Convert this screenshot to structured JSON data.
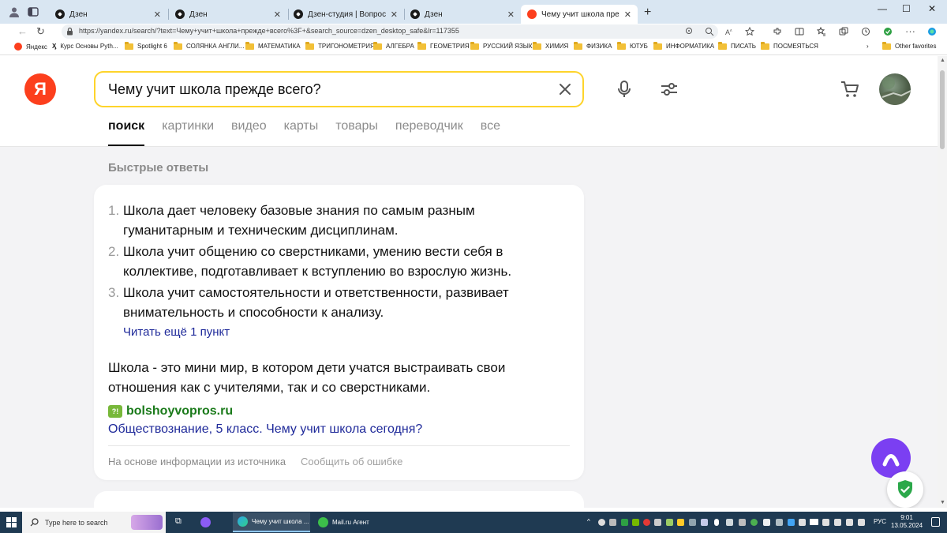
{
  "browser": {
    "tabs": [
      {
        "title": "Дзен",
        "type": "dzen"
      },
      {
        "title": "Дзен",
        "type": "dzen"
      },
      {
        "title": "Дзен-студия | Вопрос, на которо",
        "type": "dzen"
      },
      {
        "title": "Дзен",
        "type": "dzen"
      },
      {
        "title": "Чему учит школа прежде всего",
        "type": "yandex",
        "active": true
      }
    ],
    "url": "https://yandex.ru/search/?text=Чему+учит+школа+прежде+всего%3F+&search_source=dzen_desktop_safe&lr=117355",
    "bookmarks": [
      "Яндекс",
      "Курс Основы Pyth...",
      "Spotlight 6",
      "СОЛЯНКА АНГЛИ...",
      "МАТЕМАТИКА",
      "ТРИГОНОМЕТРИЯ",
      "АЛГЕБРА",
      "ГЕОМЕТРИЯ",
      "РУССКИЙ ЯЗЫК",
      "ХИМИЯ",
      "ФИЗИКА",
      "ЮТУБ",
      "ИНФОРМАТИКА",
      "ПИСАТЬ",
      "ПОСМЕЯТЬСЯ"
    ],
    "other_favorites": "Other favorites"
  },
  "search": {
    "query": "Чему учит школа прежде всего?",
    "logo": "Я",
    "tabs": [
      "поиск",
      "картинки",
      "видео",
      "карты",
      "товары",
      "переводчик",
      "все"
    ]
  },
  "quick_answers": {
    "title": "Быстрые ответы",
    "items": [
      {
        "num": "1.",
        "text": "Школа дает человеку базовые знания по самым разным гуманитарным и техническим дисциплинам."
      },
      {
        "num": "2.",
        "text": "Школа учит общению со сверстниками, умению вести себя в коллективе, подготавливает к вступлению во взрослую жизнь."
      },
      {
        "num": "3.",
        "text": "Школа учит самостоятельности и ответственности, развивает внимательность и способности к анализу."
      }
    ],
    "more_link": "Читать ещё 1 пункт",
    "summary": "Школа - это мини мир, в котором дети учатся выстраивать свои отношения как с учителями, так и со сверстниками.",
    "source_domain": "bolshoyvopros.ru",
    "source_favicon": "?!",
    "source_title": "Обществознание, 5 класс. Чему учит школа сегодня?",
    "footer_based_on": "На основе информации из источника",
    "footer_report": "Сообщить об ошибке"
  },
  "taskbar": {
    "search_placeholder": "Type here to search",
    "apps": [
      "Чему учит школа ...",
      "Mail.ru Агент"
    ],
    "lang": "РУС",
    "time": "9:01",
    "date": "13.05.2024"
  },
  "colors": {
    "yandex_red": "#fc3f1d",
    "search_border": "#fed42b",
    "link_blue": "#1f2a9a",
    "source_green": "#1a7a1a",
    "alice_purple": "#7b3ff2"
  }
}
